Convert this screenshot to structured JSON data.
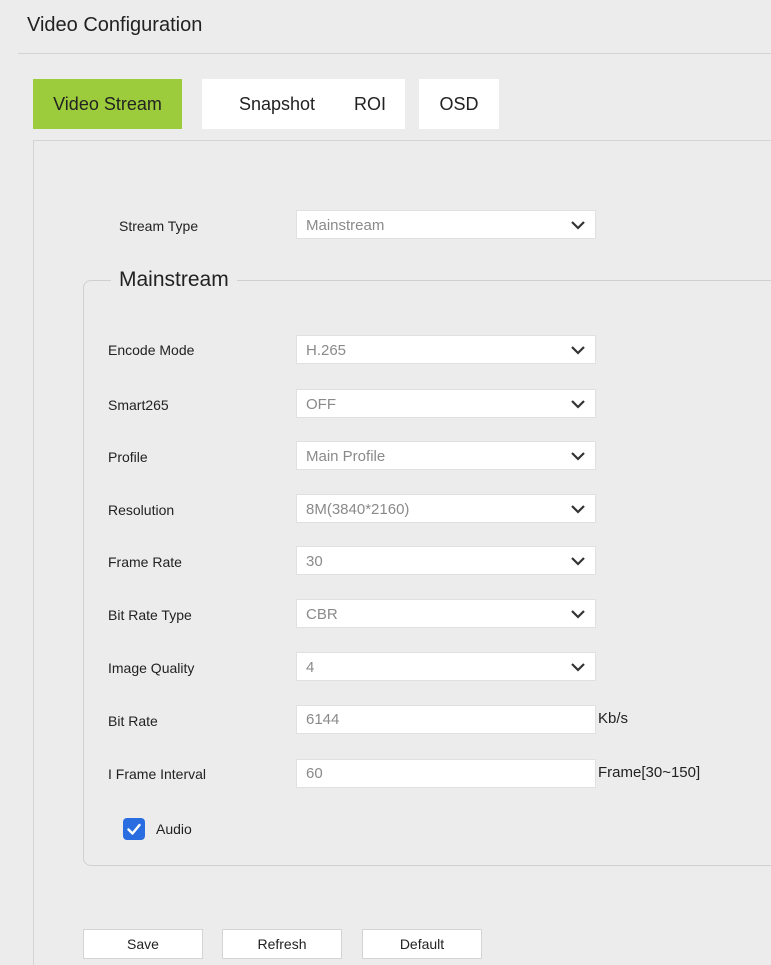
{
  "page": {
    "title": "Video Configuration"
  },
  "tabs": [
    {
      "label": "Video Stream",
      "active": true
    },
    {
      "label": "Snapshot",
      "active": false
    },
    {
      "label": "ROI",
      "active": false
    },
    {
      "label": "OSD",
      "active": false
    }
  ],
  "stream_type": {
    "label": "Stream Type",
    "value": "Mainstream"
  },
  "mainstream": {
    "legend": "Mainstream",
    "encode_mode": {
      "label": "Encode Mode",
      "value": "H.265"
    },
    "smart265": {
      "label": "Smart265",
      "value": "OFF"
    },
    "profile": {
      "label": "Profile",
      "value": "Main Profile"
    },
    "resolution": {
      "label": "Resolution",
      "value": "8M(3840*2160)"
    },
    "frame_rate": {
      "label": "Frame Rate",
      "value": "30"
    },
    "bit_rate_type": {
      "label": "Bit Rate Type",
      "value": "CBR"
    },
    "image_quality": {
      "label": "Image Quality",
      "value": "4"
    },
    "bit_rate": {
      "label": "Bit Rate",
      "value": "6144",
      "unit": "Kb/s"
    },
    "i_frame_interval": {
      "label": "I Frame Interval",
      "value": "60",
      "unit": "Frame[30~150]"
    },
    "audio": {
      "label": "Audio",
      "checked": true
    }
  },
  "buttons": {
    "save": "Save",
    "refresh": "Refresh",
    "default": "Default"
  },
  "colors": {
    "active_tab": "#9ccc3b",
    "checkbox": "#2a6de0"
  },
  "icons": {
    "select_arrow": "chevron-down-icon",
    "checkbox_mark": "checkmark-icon"
  }
}
